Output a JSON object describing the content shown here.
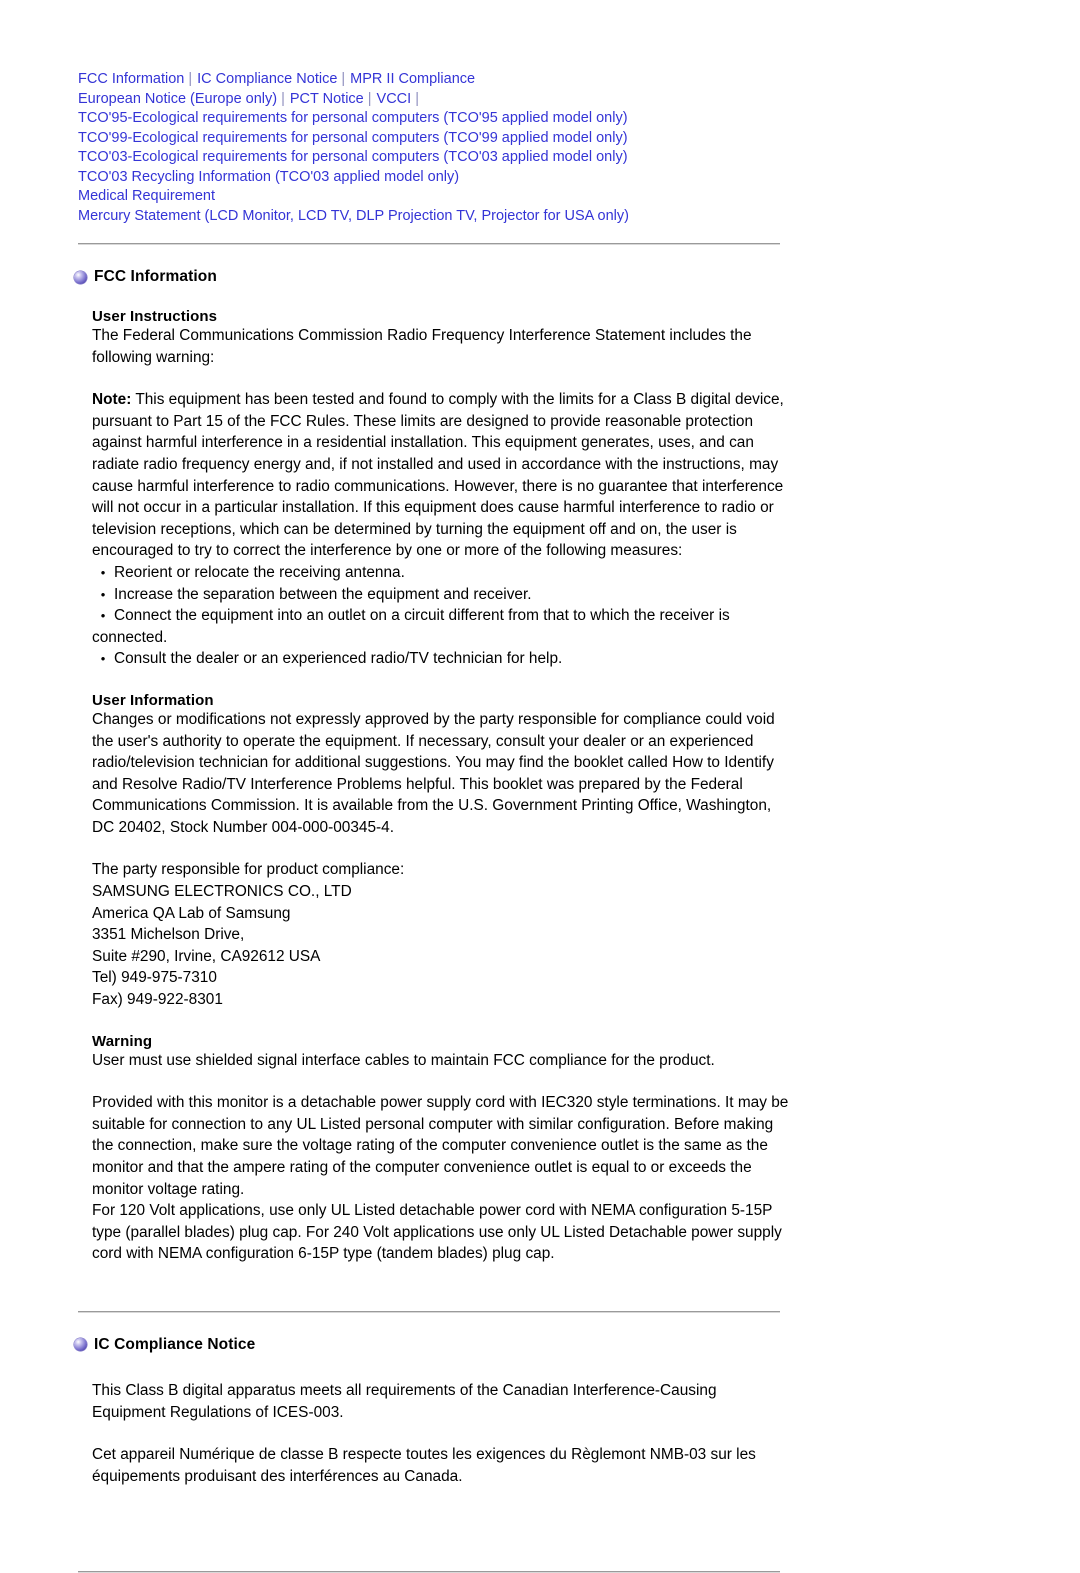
{
  "nav": {
    "rows": [
      {
        "links": [
          "FCC Information",
          "IC Compliance Notice",
          "MPR II Compliance"
        ],
        "trailing_separator": false
      },
      {
        "links": [
          "European Notice (Europe only)",
          "PCT Notice",
          "VCCI"
        ],
        "trailing_separator": true
      },
      {
        "links": [
          "TCO'95-Ecological requirements for personal computers (TCO'95 applied model only)"
        ],
        "trailing_separator": false
      },
      {
        "links": [
          "TCO'99-Ecological requirements for personal computers (TCO'99 applied model only)"
        ],
        "trailing_separator": false
      },
      {
        "links": [
          "TCO'03-Ecological requirements for personal computers (TCO'03 applied model only)"
        ],
        "trailing_separator": false
      },
      {
        "links": [
          "TCO'03 Recycling Information (TCO'03 applied model only)"
        ],
        "trailing_separator": false
      },
      {
        "links": [
          "Medical Requirement"
        ],
        "trailing_separator": false
      },
      {
        "links": [
          "Mercury Statement (LCD Monitor, LCD TV, DLP Projection TV, Projector for USA only)"
        ],
        "trailing_separator": false
      }
    ],
    "separator": "|",
    "link_color": "#3434d6"
  },
  "fcc": {
    "heading": "FCC Information",
    "bullet_icon": "purple-sphere-bullet-icon",
    "user_instructions_heading": "User Instructions",
    "intro": "The Federal Communications Commission Radio Frequency Interference Statement includes the following warning:",
    "note_label": "Note:",
    "note_body": " This equipment has been tested and found to comply with the limits for a Class B digital device, pursuant to Part 15 of the FCC Rules. These limits are designed to provide reasonable protection against harmful interference in a residential installation. This equipment generates, uses, and can radiate radio frequency energy and, if not installed and used in accordance with the instructions, may cause harmful interference to radio communications. However, there is no guarantee that interference will not occur in a particular installation. If this equipment does cause harmful interference to radio or television receptions, which can be determined by turning the equipment off and on, the user is encouraged to try to correct the interference by one or more of the following measures:",
    "bullet_glyph": "•",
    "measures": [
      "Reorient or relocate the receiving antenna.",
      "Increase the separation between the equipment and receiver.",
      "Connect the equipment into an outlet on a circuit different from that to which the receiver is connected.",
      "Consult the dealer or an experienced radio/TV technician for help."
    ],
    "user_information_heading": "User Information",
    "user_information_body": "Changes or modifications not expressly approved by the party responsible for compliance could void the user's authority to operate the equipment. If necessary, consult your dealer or an experienced radio/television technician for additional suggestions. You may find the booklet called How to Identify and Resolve Radio/TV Interference Problems helpful. This booklet was prepared by the Federal Communications Commission. It is available from the U.S. Government Printing Office, Washington, DC 20402, Stock Number 004-000-00345-4.",
    "responsible_party": {
      "intro": "The party responsible for product compliance:",
      "company": "SAMSUNG ELECTRONICS CO., LTD",
      "lab": "America QA Lab of Samsung",
      "street": "3351 Michelson Drive,",
      "city": "Suite #290, Irvine, CA92612 USA",
      "tel": "Tel) 949-975-7310",
      "fax": "Fax) 949-922-8301"
    },
    "warning_heading": "Warning",
    "warning_body": "User must use shielded signal interface cables to maintain FCC compliance for the product.",
    "cord_paragraph": "Provided with this monitor is a detachable power supply cord with IEC320 style terminations. It may be suitable for connection to any UL Listed personal computer with similar configuration. Before making the connection, make sure the voltage rating of the computer convenience outlet is the same as the monitor and that the ampere rating of the computer convenience outlet is equal to or exceeds the monitor voltage rating.",
    "nema_paragraph": "For 120 Volt applications, use only UL Listed detachable power cord with NEMA configuration 5-15P type (parallel blades) plug cap. For 240 Volt applications use only UL Listed Detachable power supply cord with NEMA configuration 6-15P type (tandem blades) plug cap."
  },
  "ic": {
    "heading": "IC Compliance Notice",
    "bullet_icon": "purple-sphere-bullet-icon",
    "english": "This Class B digital apparatus meets all requirements of the Canadian Interference-Causing Equipment Regulations of ICES-003.",
    "french": "Cet appareil Numérique de classe B respecte toutes les exigences du Règlemont NMB-03 sur les équipements produisant des interférences au Canada."
  }
}
